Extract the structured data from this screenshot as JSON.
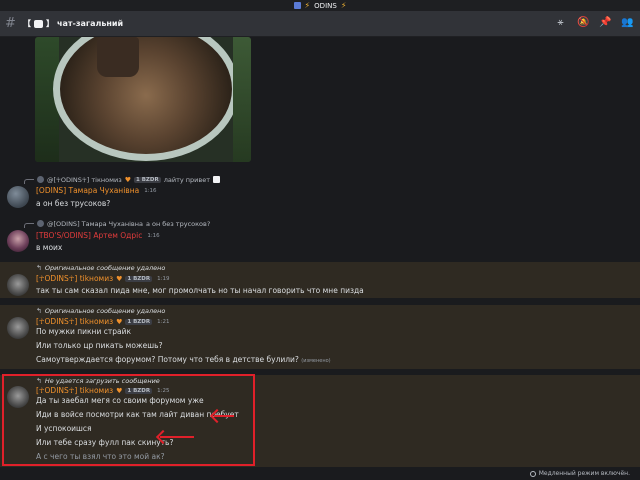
{
  "window": {
    "title": "ODINS"
  },
  "header": {
    "channel_name": "чат-загальний"
  },
  "messages": [
    {
      "reply_author": "@[☥ODINS☥] тікномиз",
      "reply_tag": "1 BZDR",
      "reply_text": "лайту привет"
    },
    {
      "author": "[ODINS] Тамара Чуханівна",
      "time": "1:16",
      "lines": [
        "а он без трусоков?"
      ]
    },
    {
      "reply_author": "@[ODINS] Тамара Чуханівна",
      "reply_text": "а он без трусоков?"
    },
    {
      "author": "[TBO'S/ODINS] Артем Одріс",
      "time": "1:16",
      "lines": [
        "в моих"
      ]
    },
    {
      "reply_text": "Оригинальное сообщение удалено",
      "author": "[☥ODINS☥] tikномиз",
      "tag": "1 BZDR",
      "time": "1:19",
      "lines": [
        "так ты сам сказал пида мне, мог промолчать но ты начал говорить что мне пизда"
      ]
    },
    {
      "reply_text": "Оригинальное сообщение удалено",
      "author": "[☥ODINS☥] tikномиз",
      "tag": "1 BZDR",
      "time": "1:21",
      "lines": [
        "По мужки пикни страйк",
        "Или только цр пикать можешь?",
        "Самоутверждается форумом? Потому что тебя в детстве булили?"
      ],
      "edited": "(изменено)"
    },
    {
      "reply_text": "Не удается загрузить сообщение",
      "author": "[☥ODINS☥] tikномиз",
      "tag": "1 BZDR",
      "time": "1:25",
      "lines": [
        "Да ты заебал мегя со своим форумом уже",
        "Иди в войсе посмотри как там лайт диван поебует",
        "И успокоишся",
        "Или тебе сразу фулл пак скинуть?",
        "А с чего ты взял что это мой ак?"
      ]
    }
  ],
  "footer": {
    "slow_mode": "Медленный режим включён."
  }
}
